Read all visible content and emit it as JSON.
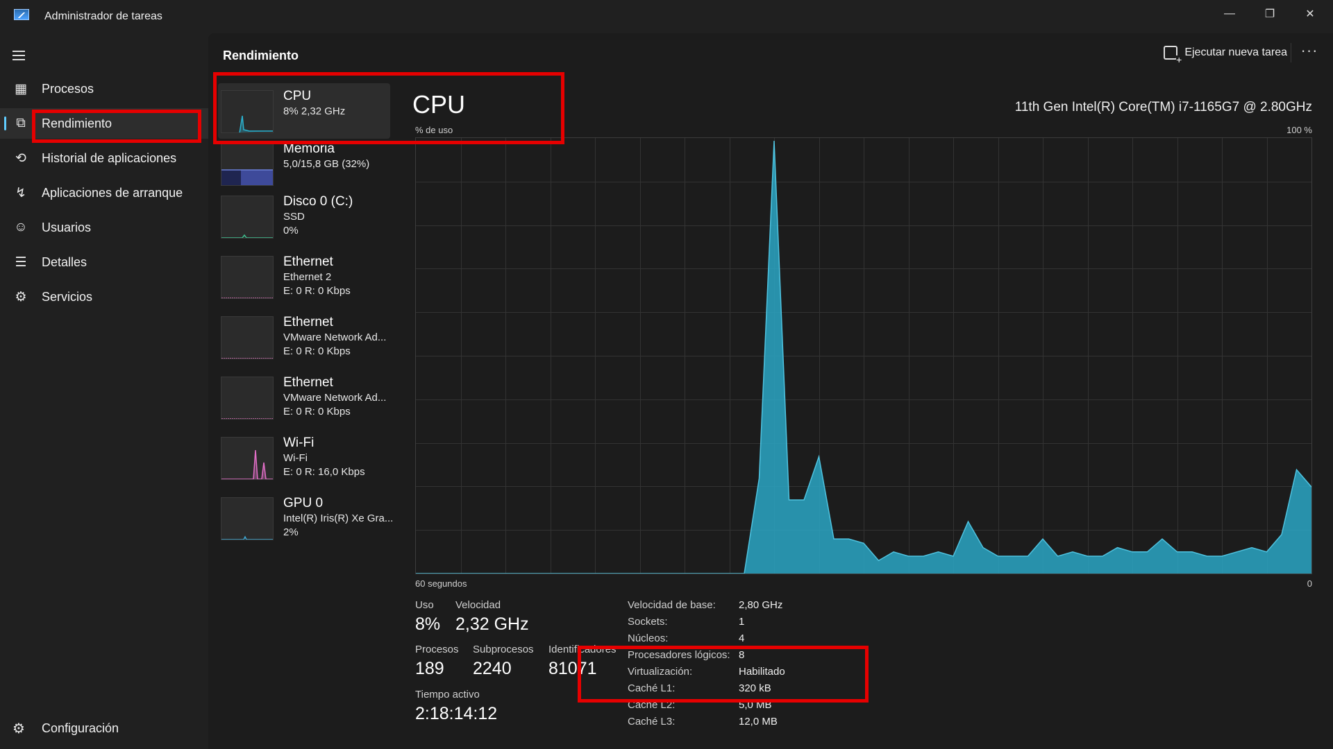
{
  "window": {
    "title": "Administrador de tareas",
    "controls": {
      "minimize": "—",
      "restore": "❐",
      "close": "✕"
    }
  },
  "sidebar": {
    "items": [
      {
        "label": "Procesos",
        "icon": "processes-icon"
      },
      {
        "label": "Rendimiento",
        "icon": "performance-icon",
        "active": true
      },
      {
        "label": "Historial de aplicaciones",
        "icon": "history-icon"
      },
      {
        "label": "Aplicaciones de arranque",
        "icon": "startup-icon"
      },
      {
        "label": "Usuarios",
        "icon": "users-icon"
      },
      {
        "label": "Detalles",
        "icon": "details-icon"
      },
      {
        "label": "Servicios",
        "icon": "services-icon"
      }
    ],
    "settings_label": "Configuración"
  },
  "header": {
    "title": "Rendimiento",
    "run_task_label": "Ejecutar nueva tarea",
    "more_label": "···"
  },
  "resources": [
    {
      "name": "CPU",
      "sub1": "8% 2,32 GHz",
      "sub2": "",
      "color": "#2bb3d1",
      "active": true
    },
    {
      "name": "Memoria",
      "sub1": "5,0/15,8 GB (32%)",
      "sub2": "",
      "color": "#6b7fd7"
    },
    {
      "name": "Disco 0 (C:)",
      "sub1": "SSD",
      "sub2": "0%",
      "color": "#3fbf8f"
    },
    {
      "name": "Ethernet",
      "sub1": "Ethernet 2",
      "sub2": "E: 0 R: 0 Kbps",
      "color": "#d36fb3"
    },
    {
      "name": "Ethernet",
      "sub1": "VMware Network Ad...",
      "sub2": "E: 0 R: 0 Kbps",
      "color": "#d36fb3"
    },
    {
      "name": "Ethernet",
      "sub1": "VMware Network Ad...",
      "sub2": "E: 0 R: 0 Kbps",
      "color": "#d36fb3"
    },
    {
      "name": "Wi-Fi",
      "sub1": "Wi-Fi",
      "sub2": "E: 0 R: 16,0 Kbps",
      "color": "#e36fc8"
    },
    {
      "name": "GPU 0",
      "sub1": "Intel(R) Iris(R) Xe Gra...",
      "sub2": "2%",
      "color": "#3fa9d6"
    }
  ],
  "cpu": {
    "big_title": "CPU",
    "model": "11th Gen Intel(R) Core(TM) i7-1165G7 @ 2.80GHz",
    "y_caption": "% de uso",
    "y_max": "100 %",
    "x_left": "60 segundos",
    "x_right": "0",
    "graph_color": "#2aa6c4"
  },
  "chart_data": {
    "type": "area",
    "x": [
      0,
      1,
      2,
      3,
      4,
      5,
      6,
      7,
      8,
      9,
      10,
      11,
      12,
      13,
      14,
      15,
      16,
      17,
      18,
      19,
      20,
      21,
      22,
      23,
      24,
      25,
      26,
      27,
      28,
      29,
      30,
      31,
      32,
      33,
      34,
      35,
      36,
      37,
      38,
      39,
      40,
      41,
      42,
      43,
      44,
      45,
      46,
      47,
      48,
      49,
      50,
      51,
      52,
      53,
      54,
      55,
      56,
      57,
      58,
      59,
      60
    ],
    "values": [
      0,
      0,
      0,
      0,
      0,
      0,
      0,
      0,
      0,
      0,
      0,
      0,
      0,
      0,
      0,
      0,
      0,
      0,
      0,
      0,
      0,
      0,
      0,
      22,
      100,
      17,
      17,
      27,
      8,
      8,
      7,
      3,
      5,
      4,
      4,
      5,
      4,
      12,
      6,
      4,
      4,
      4,
      8,
      4,
      5,
      4,
      4,
      6,
      5,
      5,
      8,
      5,
      5,
      4,
      4,
      5,
      6,
      5,
      9,
      24,
      20
    ],
    "ylim": [
      0,
      100
    ],
    "xlabel": "60 segundos",
    "ylabel": "% de uso"
  },
  "stats": {
    "uso_label": "Uso",
    "uso_value": "8%",
    "velocidad_label": "Velocidad",
    "velocidad_value": "2,32 GHz",
    "procesos_label": "Procesos",
    "procesos_value": "189",
    "subprocesos_label": "Subprocesos",
    "subprocesos_value": "2240",
    "identificadores_label": "Identificadores",
    "identificadores_value": "81071",
    "tiempo_label": "Tiempo activo",
    "tiempo_value": "2:18:14:12"
  },
  "specs": [
    {
      "label": "Velocidad de base:",
      "value": "2,80 GHz"
    },
    {
      "label": "Sockets:",
      "value": "1"
    },
    {
      "label": "Núcleos:",
      "value": "4"
    },
    {
      "label": "Procesadores lógicos:",
      "value": "8"
    },
    {
      "label": "Virtualización:",
      "value": "Habilitado"
    },
    {
      "label": "Caché L1:",
      "value": "320 kB"
    },
    {
      "label": "Caché L2:",
      "value": "5,0 MB"
    },
    {
      "label": "Caché L3:",
      "value": "12,0 MB"
    }
  ],
  "highlight_color": "#e60000"
}
